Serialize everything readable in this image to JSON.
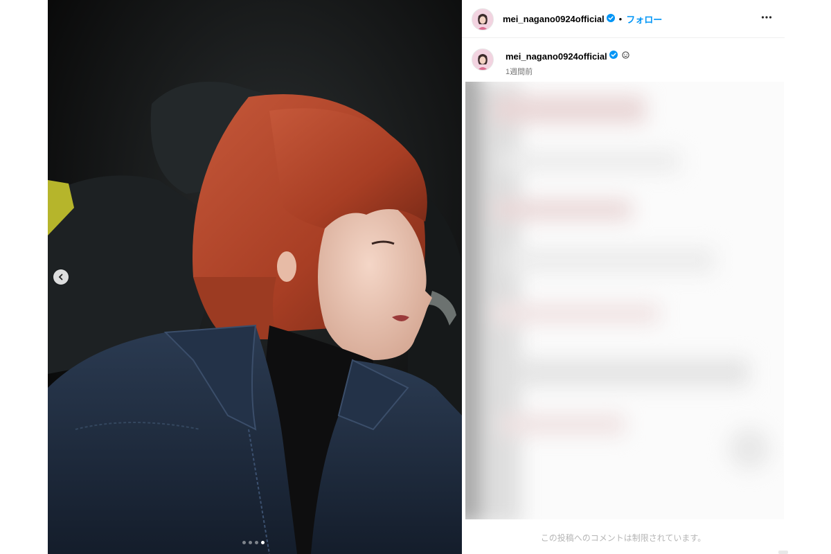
{
  "post": {
    "username": "mei_nagano0924official",
    "follow_label": "フォロー",
    "separator": "•",
    "time_ago": "1週間前",
    "comments_restricted": "この投稿へのコメントは制限されています。",
    "carousel": {
      "total": 4,
      "active_index": 4
    }
  },
  "icons": {
    "verified": "verified-badge-icon",
    "more": "more-options-icon",
    "prev": "chevron-left-icon",
    "emoji": "smiley-icon"
  },
  "colors": {
    "follow": "#0095f6",
    "verified": "#0095f6",
    "muted_text": "#737373",
    "hair": "#b3472a",
    "jacket": "#1e2b3e"
  }
}
